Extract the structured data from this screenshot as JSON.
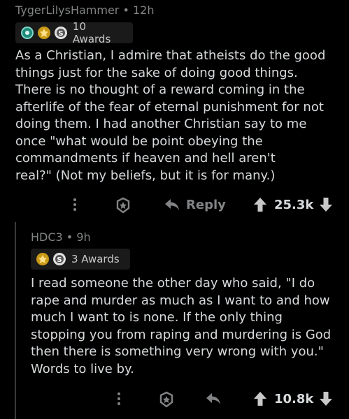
{
  "comments": [
    {
      "username": "TygerLilysHammer",
      "separator": "•",
      "age": "12h",
      "awards_label": "10 Awards",
      "body": "As a Christian, I admire that atheists do the good\nthings just  for the sake of doing good things.\nThere is no thought of a reward coming in the\nafterlife of the fear of eternal punishment for not\ndoing them.  I had another Christian say to me\nonce \"what would  be point obeying the\ncommandments if heaven and hell aren't\nreal?\"  (Not my beliefs, but it is for many.)",
      "reply_label": "Reply",
      "score": "25.3k"
    },
    {
      "username": "HDC3",
      "separator": "•",
      "age": "9h",
      "awards_label": "3 Awards",
      "body": "I read someone the other day who said, \"I do\nrape and murder as much as I want to and how\nmuch I want to is none. If the only thing\nstopping you from raping and murdering is God\nthen there is something very wrong with you.\"\nWords to live by.",
      "score": "10.8k"
    }
  ],
  "icons": [
    "more-options-icon",
    "award-icon",
    "reply-arrow-icon",
    "upvote-icon",
    "downvote-icon",
    "platinum-award-icon",
    "gold-award-icon",
    "silver-award-icon"
  ]
}
